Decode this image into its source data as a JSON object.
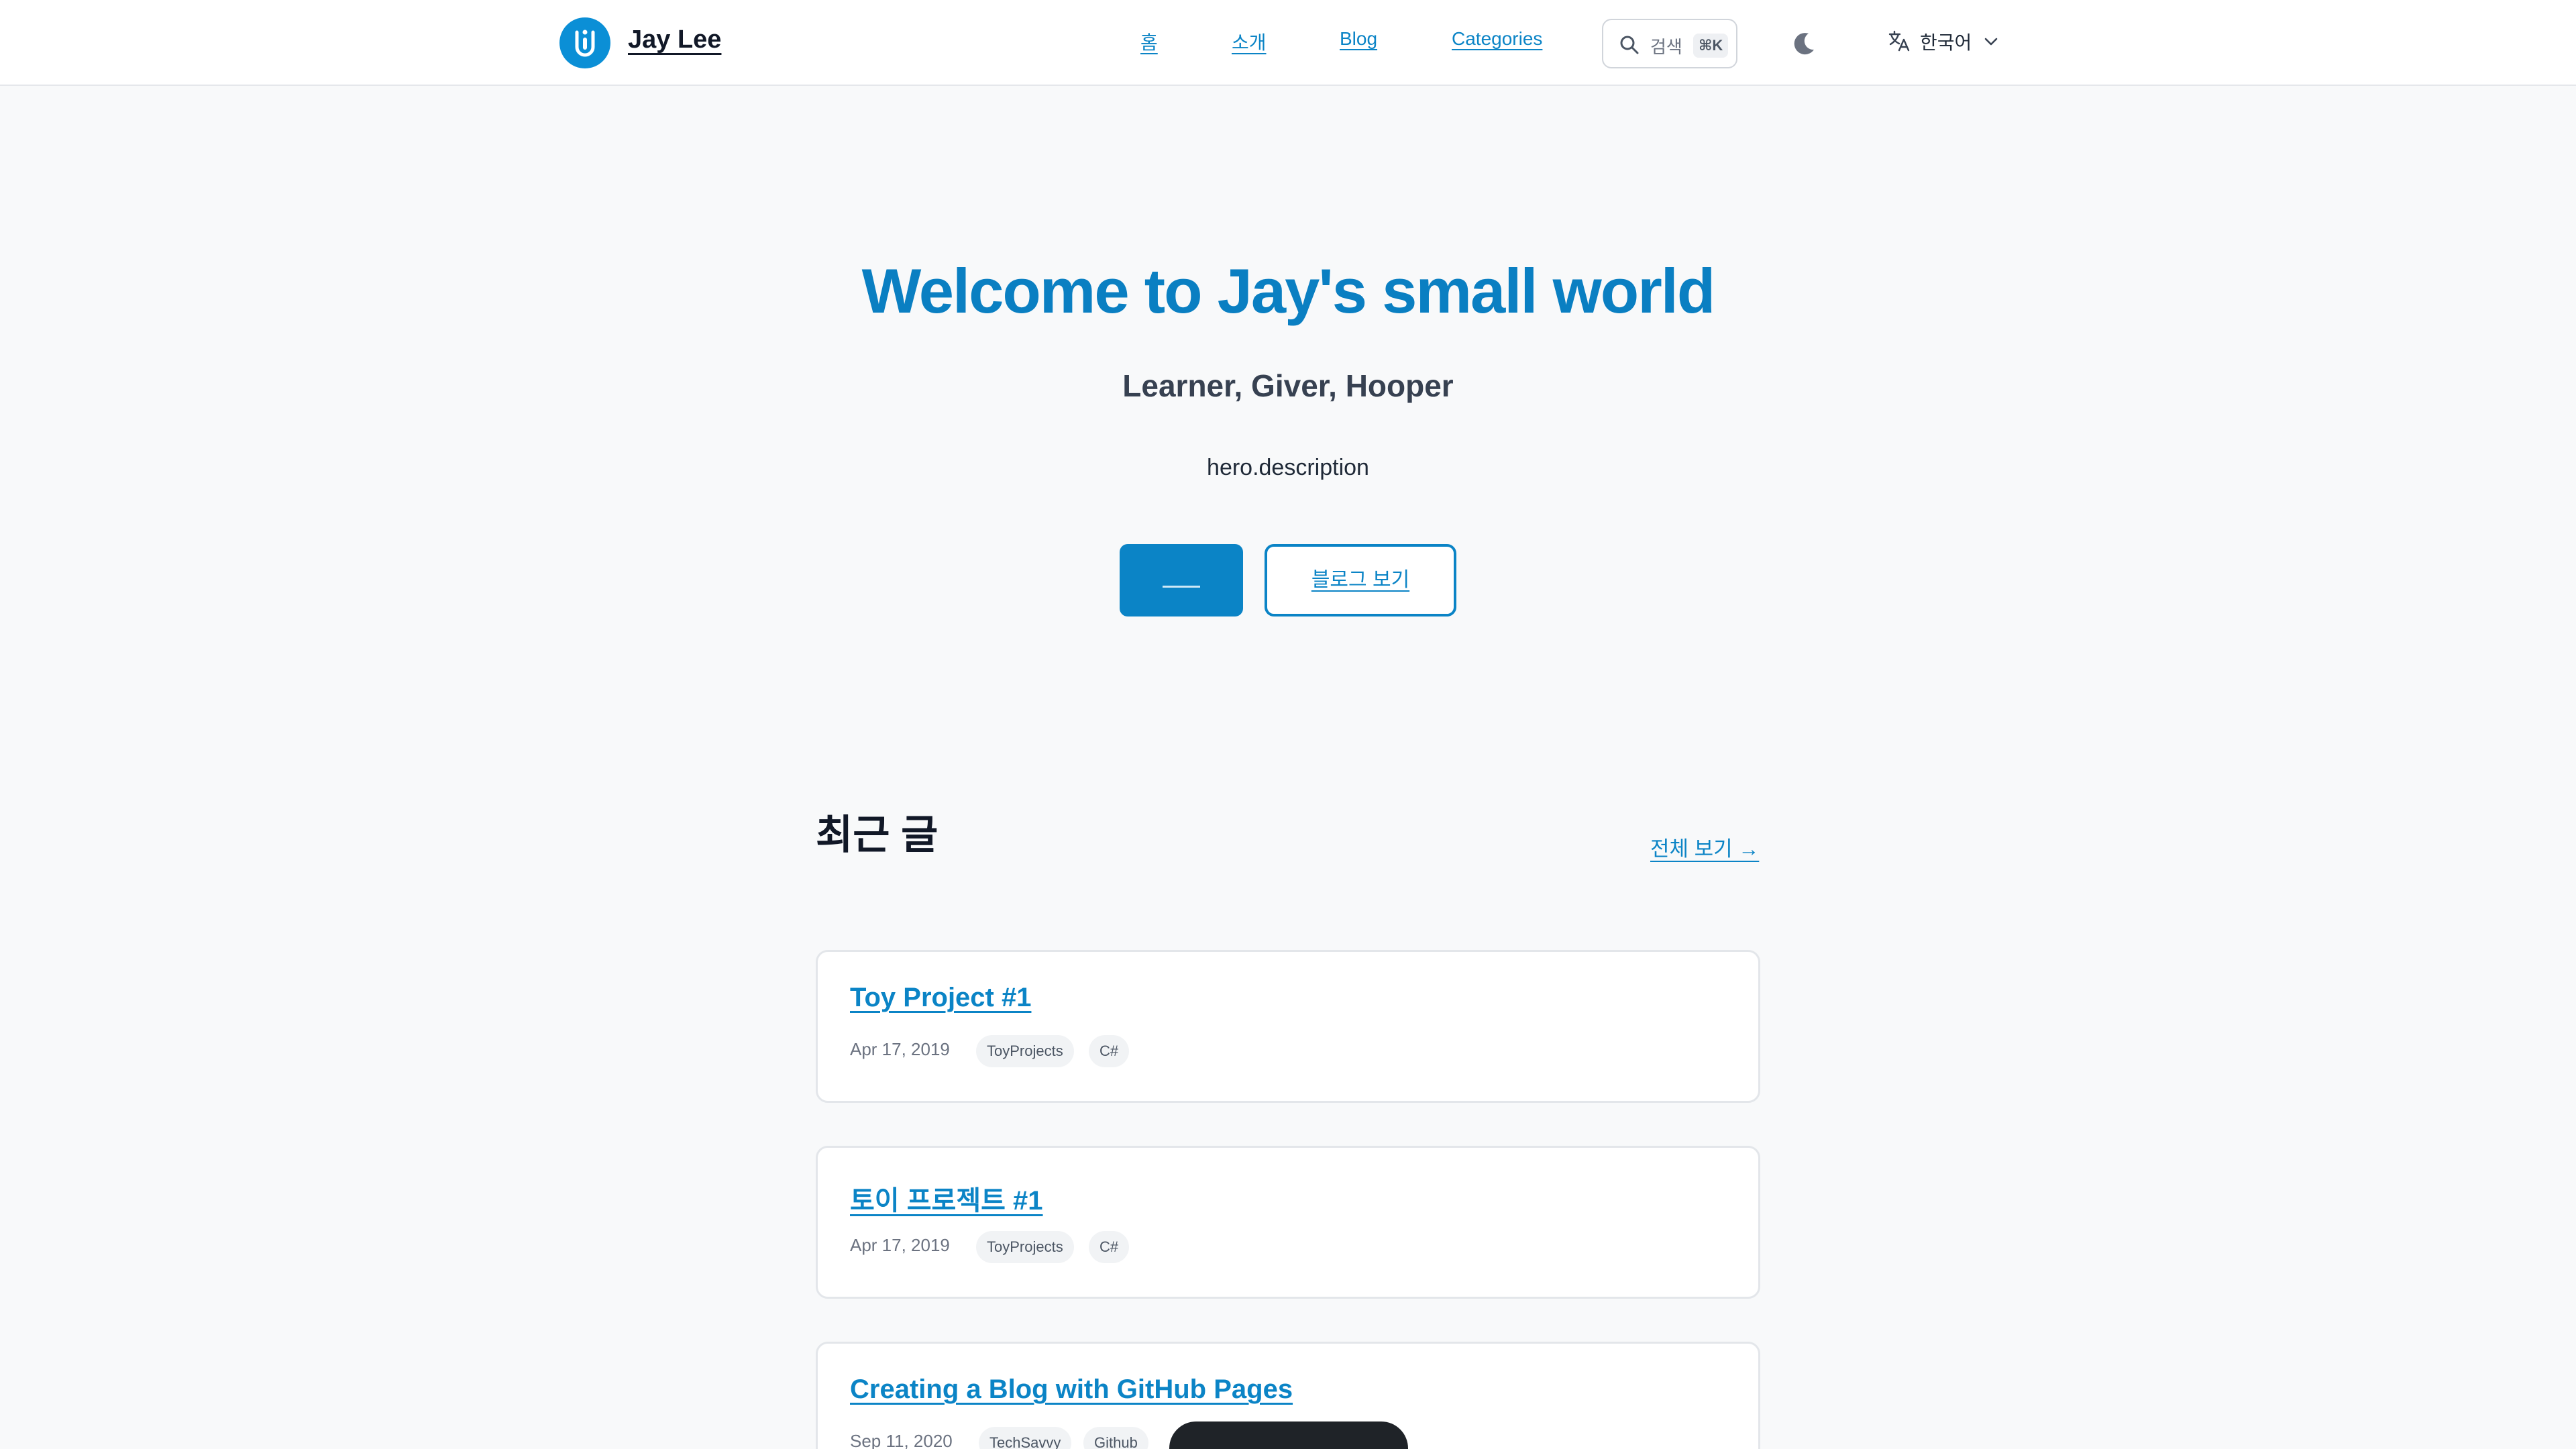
{
  "header": {
    "brand": "Jay Lee",
    "nav": [
      "홈",
      "소개",
      "Blog",
      "Categories"
    ],
    "search_label": "검색",
    "search_shortcut": "⌘K",
    "language": "한국어"
  },
  "hero": {
    "title": "Welcome to Jay's small world",
    "subtitle": "Learner, Giver, Hooper",
    "description": "hero.description",
    "secondary_button": "블로그 보기"
  },
  "recent": {
    "title": "최근 글",
    "view_all": "전체 보기 →",
    "posts": [
      {
        "title": "Toy Project #1",
        "date": "Apr 17, 2019",
        "tags": [
          "ToyProjects",
          "C#"
        ]
      },
      {
        "title": "토이 프로젝트 #1",
        "date": "Apr 17, 2019",
        "tags": [
          "ToyProjects",
          "C#"
        ]
      },
      {
        "title": "Creating a Blog with GitHub Pages",
        "date": "Sep 11, 2020",
        "tags": [
          "TechSavvy",
          "Github"
        ]
      }
    ]
  },
  "colors": {
    "accent": "#0b84c6",
    "background": "#f8f9fa"
  }
}
